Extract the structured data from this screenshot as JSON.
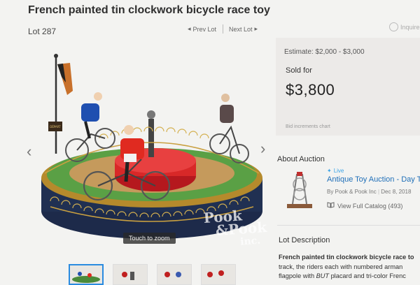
{
  "title": "French painted tin clockwork bicycle race toy",
  "lot": {
    "label": "Lot 287",
    "prev_label": "Prev Lot",
    "next_label": "Next Lot",
    "inquire_label": "Inquire"
  },
  "gallery": {
    "zoom_hint": "Touch to zoom",
    "watermark_line1": "Pook",
    "watermark_line2": "&Pook",
    "watermark_line3": "inc.",
    "flag_sign": "DÉPART",
    "thumbnail_count": 4,
    "active_thumbnail": 1
  },
  "pricing": {
    "estimate": "Estimate: $2,000 - $3,000",
    "sold_label": "Sold for",
    "sold_price": "$3,800",
    "bid_chart_link": "Bid increments chart"
  },
  "about": {
    "heading": "About Auction",
    "live_badge": "Live",
    "auction_name": "Antique Toy Auction - Day Two",
    "byline": "By Pook & Pook Inc",
    "date": "Dec 8, 2018",
    "catalog_link": "View Full Catalog (493)"
  },
  "description": {
    "heading": "Lot Description",
    "line1_bold": "French painted tin clockwork bicycle race to",
    "line2": "track, the riders each with numbered arman",
    "line3_pre": "flagpole with ",
    "line3_italic": "BUT",
    "line3_post": " placard and tri-color Frenc"
  },
  "colors": {
    "accent_blue": "#1f6fb8",
    "live_blue": "#3aa3e6",
    "panel_bg": "#eceae8",
    "page_bg": "#f3f3f1"
  }
}
